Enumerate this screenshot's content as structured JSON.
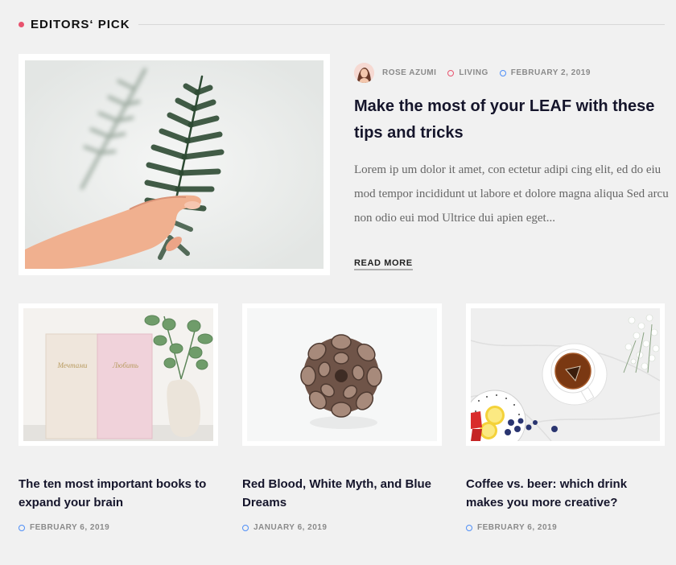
{
  "section": {
    "title": "EDITORS‘ PICK"
  },
  "featured": {
    "author": "ROSE AZUMI",
    "category": "LIVING",
    "date": "FEBRUARY 2, 2019",
    "title": "Make the most of your LEAF with these tips and tricks",
    "excerpt": "Lorem ip um dolor it amet, con ectetur adipi cing elit, ed do eiu mod tempor incididunt ut labore et dolore magna aliqua Sed arcu non odio eui mod Ultrice dui apien eget...",
    "read_more": "READ MORE"
  },
  "cards": [
    {
      "title": "The ten most important books to expand your brain",
      "date": "FEBRUARY 6, 2019",
      "book1_text": "Мечтами",
      "book2_text": "Любить"
    },
    {
      "title": "Red Blood, White Myth, and Blue Dreams",
      "date": "JANUARY 6, 2019"
    },
    {
      "title": "Coffee vs. beer: which drink makes you more creative?",
      "date": "FEBRUARY 6, 2019"
    }
  ],
  "colors": {
    "accent": "#e8536e",
    "date_ring": "#4f8ff7",
    "background": "#f1f1f1"
  }
}
